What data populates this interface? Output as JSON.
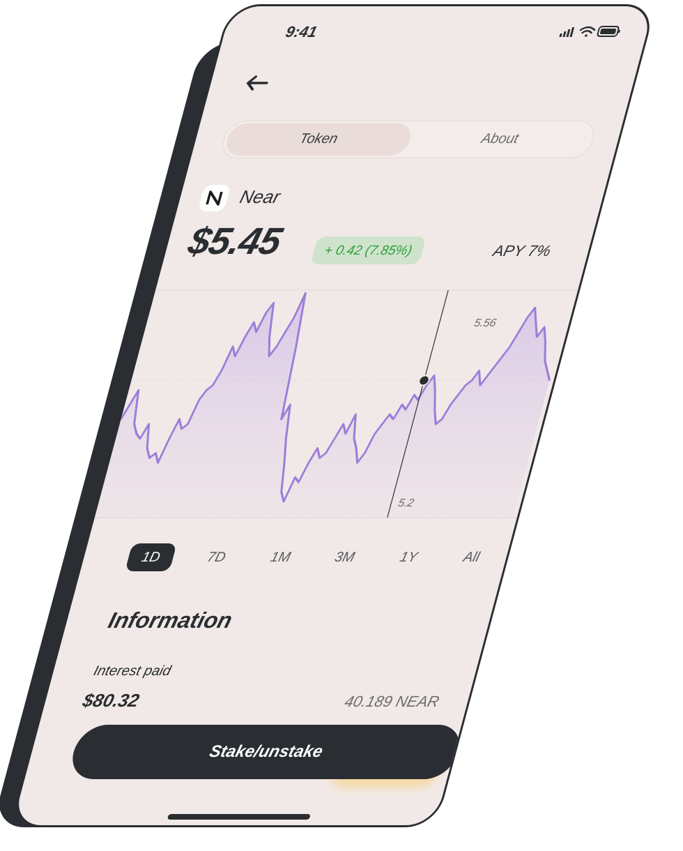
{
  "status_bar": {
    "time": "9:41"
  },
  "tabs": [
    {
      "label": "Token",
      "active": true
    },
    {
      "label": "About",
      "active": false
    }
  ],
  "token": {
    "name": "Near",
    "price": "$5.45",
    "change": "+ 0.42 (7.85%)",
    "apy": "APY 7%"
  },
  "chart_data": {
    "type": "area",
    "y_labels": [
      "5.56",
      "5.2"
    ],
    "cursor_value": 5.45,
    "color": "#9c7ed9",
    "values": [
      5.37,
      5.4,
      5.43,
      5.36,
      5.34,
      5.33,
      5.36,
      5.31,
      5.29,
      5.3,
      5.28,
      5.33,
      5.37,
      5.35,
      5.36,
      5.41,
      5.43,
      5.44,
      5.47,
      5.52,
      5.5,
      5.54,
      5.57,
      5.55,
      5.59,
      5.61,
      5.54,
      5.5,
      5.52,
      5.55,
      5.58,
      5.63,
      5.52,
      5.37,
      5.4,
      5.33,
      5.28,
      5.22,
      5.2,
      5.25,
      5.24,
      5.28,
      5.31,
      5.29,
      5.3,
      5.33,
      5.36,
      5.34,
      5.38,
      5.33,
      5.31,
      5.28,
      5.3,
      5.34,
      5.36,
      5.38,
      5.37,
      5.4,
      5.39,
      5.42,
      5.41,
      5.44,
      5.46,
      5.43,
      5.39,
      5.36,
      5.37,
      5.4,
      5.42,
      5.44,
      5.45,
      5.47,
      5.44,
      5.46,
      5.48,
      5.5,
      5.52,
      5.55,
      5.58,
      5.6,
      5.57,
      5.54,
      5.56,
      5.53,
      5.49,
      5.47,
      5.45
    ]
  },
  "ranges": [
    {
      "label": "1D",
      "active": true
    },
    {
      "label": "7D",
      "active": false
    },
    {
      "label": "1M",
      "active": false
    },
    {
      "label": "3M",
      "active": false
    },
    {
      "label": "1Y",
      "active": false
    },
    {
      "label": "All",
      "active": false
    }
  ],
  "information": {
    "title": "Information",
    "interest_label": "Interest paid",
    "interest_usd": "$80.32",
    "interest_near": "40.189 NEAR"
  },
  "actions": {
    "stake_label": "Stake/unstake"
  }
}
